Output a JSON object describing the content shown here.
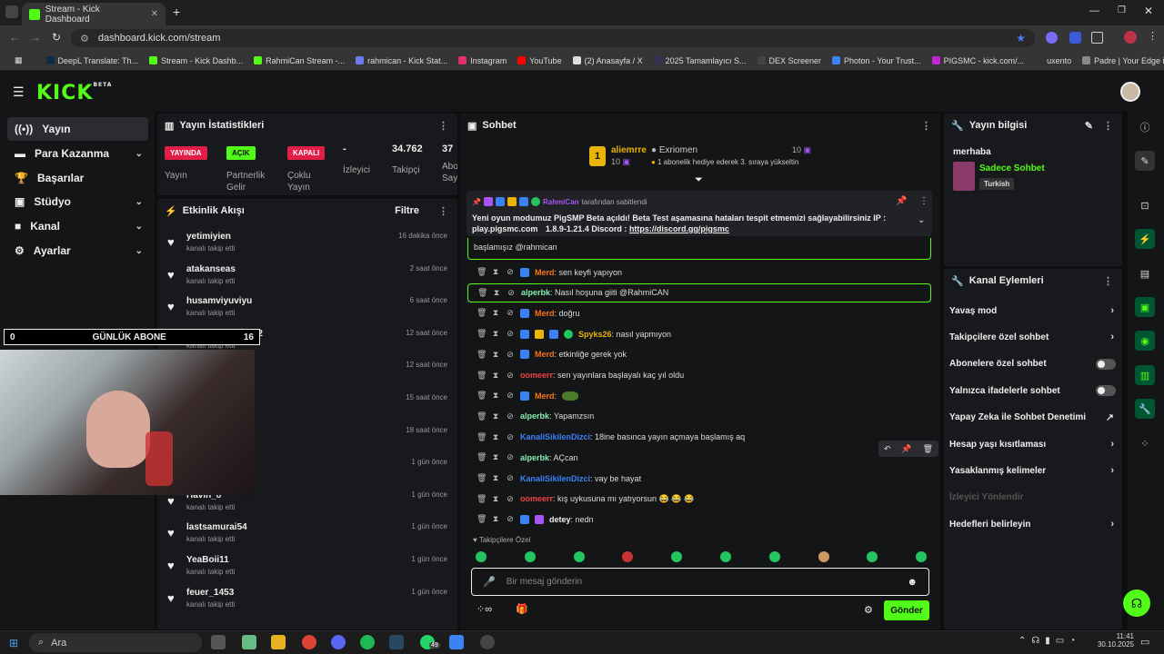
{
  "browser": {
    "tab_title": "Stream - Kick Dashboard",
    "url": "dashboard.kick.com/stream",
    "bookmarks": [
      "DeepL Translate: Th...",
      "Stream - Kick Dashb...",
      "RahmiCan Stream -...",
      "rahmican - Kick Stat...",
      "Instagram",
      "YouTube",
      "(2) Anasayfa / X",
      "2025 Tamamlayıcı S...",
      "DEX Screener",
      "Photon - Your Trust...",
      "PIGSMC - kick.com/...",
      "uxento",
      "Padre | Your Edge in..."
    ]
  },
  "brand": {
    "logo": "KICK",
    "beta": "BETA",
    "accent": "#53fc18"
  },
  "nav": [
    {
      "label": "Yayın"
    },
    {
      "label": "Para Kazanma"
    },
    {
      "label": "Başarılar"
    },
    {
      "label": "Stüdyo"
    },
    {
      "label": "Kanal"
    },
    {
      "label": "Ayarlar"
    }
  ],
  "stats": {
    "title": "Yayın İstatistikleri",
    "badges": [
      {
        "text": "YAYINDA",
        "label": "Yayın"
      },
      {
        "text": "AÇIK",
        "label": "Partnerlik Gelir"
      },
      {
        "text": "KAPALI",
        "label": "Çoklu Yayın"
      }
    ],
    "izleyici": {
      "value": "-",
      "label": "İzleyici"
    },
    "takipci": {
      "value": "34.762",
      "label": "Takipçi"
    },
    "abone": {
      "value": "37",
      "label": "Abo Say"
    }
  },
  "activity": {
    "title": "Etkinlik Akışı",
    "filter": "Filtre",
    "sub": "kanalı takip etti",
    "items": [
      {
        "user": "yetimiyien",
        "time": "16 dakika önce"
      },
      {
        "user": "atakanseas",
        "time": "2 saat önce"
      },
      {
        "user": "husamviyuviyu",
        "time": "6 saat önce"
      },
      {
        "user": "throwbanlamaz42",
        "time": "12 saat önce"
      },
      {
        "user": "",
        "time": "12 saat önce"
      },
      {
        "user": "",
        "time": "15 saat önce"
      },
      {
        "user": "",
        "time": "18 saat önce"
      },
      {
        "user": "",
        "time": "1 gün önce"
      },
      {
        "user": "Havin_8",
        "time": "1 gün önce"
      },
      {
        "user": "lastsamurai54",
        "time": "1 gün önce"
      },
      {
        "user": "YeaBoii11",
        "time": "1 gün önce"
      },
      {
        "user": "feuer_1453",
        "time": "1 gün önce"
      }
    ]
  },
  "overlay": {
    "left": "0",
    "center": "GÜNLÜK ABONE",
    "right": "16"
  },
  "chat": {
    "title": "Sohbet",
    "leader": {
      "rank": "1",
      "name": "aliemrre",
      "count": "10"
    },
    "second": {
      "name": "Exriomen",
      "count": "10",
      "note": "1 abonelik hediye ederek 3. sıraya yükseltin"
    },
    "pinned": {
      "by": "RahmiCan",
      "by_suffix": "tarafından sabitlendi",
      "text": "Yeni oyun modumuz PigSMP Beta açıldı! Beta Test aşamasına hataları tespit etmemizi sağlayabilirsiniz IP : play.pigsmc.com",
      "text2": "1.8.9-1.21.4 Discord :",
      "link": "https://discord.gg/pigsmc"
    },
    "partial": "başlamışız @rahmican",
    "messages": [
      {
        "user": "Merd",
        "color": "#f97316",
        "text": ": sen keyfi yapıyon"
      },
      {
        "user": "alperbk",
        "color": "#86efac",
        "text": ": Nasıl hoşuna giiti @RahmiCAN"
      },
      {
        "user": "Merd",
        "color": "#f97316",
        "text": ": doğru"
      },
      {
        "user": "Spyks26",
        "color": "#eab308",
        "text": ": nasıl yapmıyon"
      },
      {
        "user": "Merd",
        "color": "#f97316",
        "text": ": etkinliğe gerek yok"
      },
      {
        "user": "oomeerr",
        "color": "#ef4444",
        "text": ": sen yayınlara başlayalı kaç yıl oldu"
      },
      {
        "user": "Merd",
        "color": "#f97316",
        "text": ":"
      },
      {
        "user": "alperbk",
        "color": "#86efac",
        "text": ": Yapamzsın"
      },
      {
        "user": "KanaliSikilenDizci",
        "color": "#3b82f6",
        "text": ": 18ine basınca yayın açmaya başlamış aq"
      },
      {
        "user": "alperbk",
        "color": "#86efac",
        "text": ": AÇcan"
      },
      {
        "user": "KanaliSikilenDizci",
        "color": "#3b82f6",
        "text": ": vay be hayat"
      },
      {
        "user": "oomeerr",
        "color": "#ef4444",
        "text": ": kış uykusuna mı yatıyorsun 😂 😂 😂"
      },
      {
        "user": "detey",
        "color": "#eee",
        "text": ": nedn"
      }
    ],
    "followers_only": "Takipçilere Özel",
    "input_placeholder": "Bir mesaj gönderin",
    "send": "Gönder"
  },
  "info": {
    "title": "Yayın bilgisi",
    "stream_title": "merhaba",
    "category": "Sadece Sohbet",
    "tag": "Turkish"
  },
  "actions": {
    "title": "Kanal Eylemleri",
    "items": [
      "Yavaş mod",
      "Takipçilere özel sohbet",
      "Abonelere özel sohbet",
      "Yalnızca ifadelerle sohbet",
      "Yapay Zeka ile Sohbet Denetimi",
      "Hesap yaşı kısıtlaması",
      "Yasaklanmış kelimeler",
      "İzleyici Yönlendir",
      "Hedefleri belirleyin"
    ]
  },
  "taskbar": {
    "search": "Ara",
    "time": "11:41",
    "date": "30.10.2025",
    "wa_badge": "49"
  }
}
